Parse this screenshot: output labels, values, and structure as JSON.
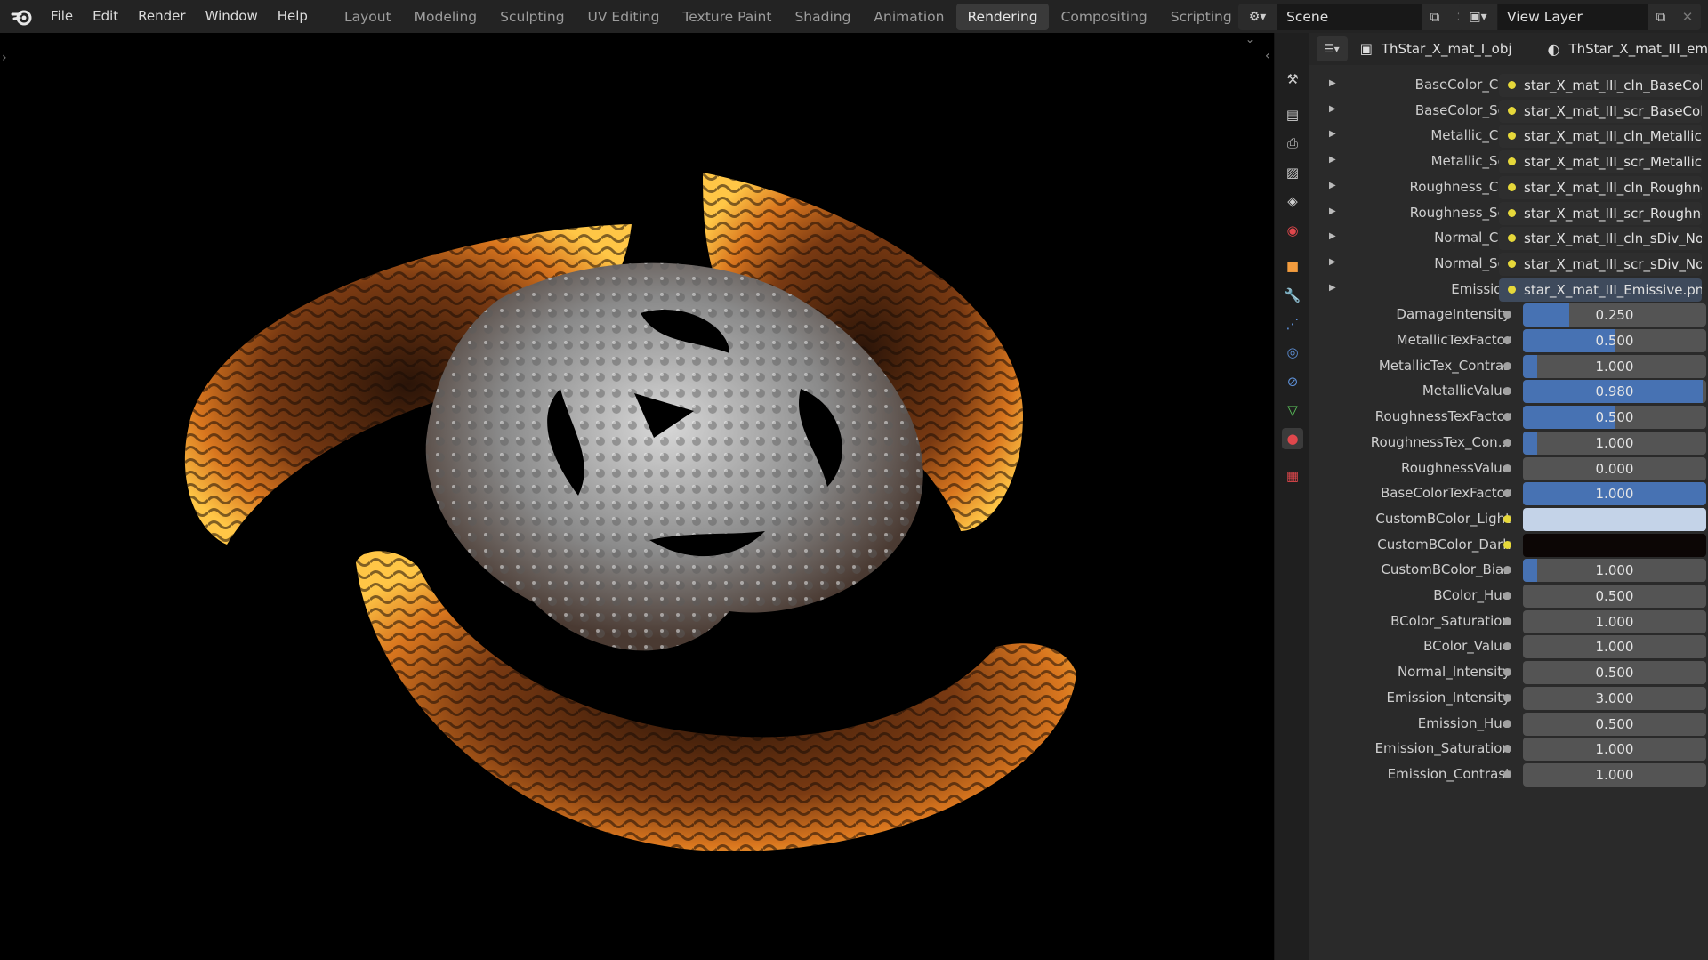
{
  "menu": [
    "File",
    "Edit",
    "Render",
    "Window",
    "Help"
  ],
  "workspaces": [
    {
      "label": "Layout",
      "active": false
    },
    {
      "label": "Modeling",
      "active": false
    },
    {
      "label": "Sculpting",
      "active": false
    },
    {
      "label": "UV Editing",
      "active": false
    },
    {
      "label": "Texture Paint",
      "active": false
    },
    {
      "label": "Shading",
      "active": false
    },
    {
      "label": "Animation",
      "active": false
    },
    {
      "label": "Rendering",
      "active": true
    },
    {
      "label": "Compositing",
      "active": false
    },
    {
      "label": "Scripting",
      "active": false
    }
  ],
  "add_workspace": "+",
  "scene": {
    "label": "Scene"
  },
  "view_layer": {
    "label": "View Layer"
  },
  "props_header": {
    "object": "ThStar_X_mat_I_obj",
    "material": "ThStar_X_mat_III_em"
  },
  "texture_rows": [
    {
      "label": "BaseColor_Cln",
      "value": "star_X_mat_III_cln_BaseCol..."
    },
    {
      "label": "BaseColor_Scr",
      "value": "star_X_mat_III_scr_BaseCol..."
    },
    {
      "label": "Metallic_Cln",
      "value": "star_X_mat_III_cln_Metallic...."
    },
    {
      "label": "Metallic_Scr",
      "value": "star_X_mat_III_scr_Metallic...."
    },
    {
      "label": "Roughness_Cln",
      "value": "star_X_mat_III_cln_Roughne..."
    },
    {
      "label": "Roughness_Scr",
      "value": "star_X_mat_III_scr_Roughne..."
    },
    {
      "label": "Normal_Cln",
      "value": "star_X_mat_III_cln_sDiv_Nor..."
    },
    {
      "label": "Normal_Scr",
      "value": "star_X_mat_III_scr_sDiv_Nor..."
    },
    {
      "label": "Emission",
      "value": "star_X_mat_III_Emissive.png",
      "selected": true
    }
  ],
  "value_rows": [
    {
      "label": "DamageIntensity",
      "value": "0.250",
      "fill": 0.25
    },
    {
      "label": "MetallicTexFactor",
      "value": "0.500",
      "fill": 0.5
    },
    {
      "label": "MetallicTex_Contras",
      "value": "1.000",
      "fill": 0.08
    },
    {
      "label": "MetallicValue",
      "value": "0.980",
      "fill": 0.98
    },
    {
      "label": "RoughnessTexFactor",
      "value": "0.500",
      "fill": 0.5
    },
    {
      "label": "RoughnessTex_Con...",
      "value": "1.000",
      "fill": 0.08
    },
    {
      "label": "RoughnessValue",
      "value": "0.000",
      "fill": 0
    },
    {
      "label": "BaseColorTexFactor",
      "value": "1.000",
      "fill": 1.0
    },
    {
      "label": "CustomBColor_Light",
      "color": "#c4d3e8"
    },
    {
      "label": "CustomBColor_Dark",
      "color": "#0c0605"
    },
    {
      "label": "CustomBColor_Bias",
      "value": "1.000",
      "fill": 0.08
    },
    {
      "label": "BColor_Hue",
      "value": "0.500",
      "fill": 0
    },
    {
      "label": "BColor_Saturation",
      "value": "1.000",
      "fill": 0
    },
    {
      "label": "BColor_Value",
      "value": "1.000",
      "fill": 0
    },
    {
      "label": "Normal_Intensity",
      "value": "0.500",
      "fill": 0
    },
    {
      "label": "Emission_Intensity",
      "value": "3.000",
      "fill": 0
    },
    {
      "label": "Emission_Hue",
      "value": "0.500",
      "fill": 0
    },
    {
      "label": "Emission_Saturation",
      "value": "1.000",
      "fill": 0
    },
    {
      "label": "Emission_Contrast",
      "value": "1.000",
      "fill": 0
    }
  ],
  "colors": {
    "accent": "#4772b3",
    "socket_yellow": "#e6d83a",
    "socket_grey": "#a0a0a0",
    "glow": "#ffb22e"
  }
}
